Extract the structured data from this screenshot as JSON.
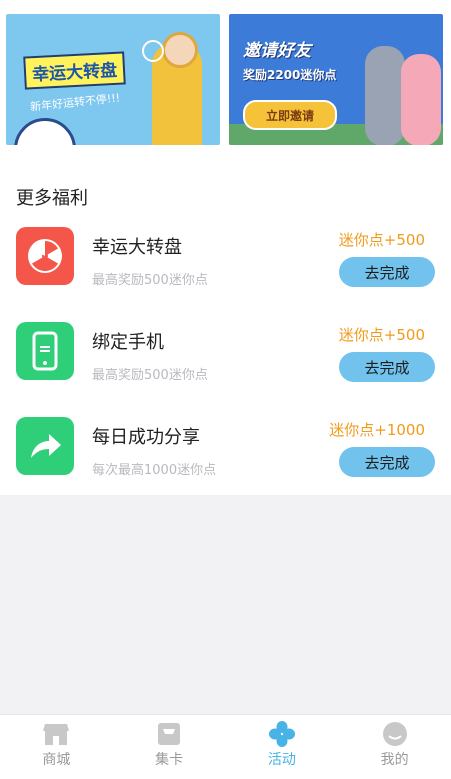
{
  "banners": {
    "left": {
      "title": "幸运大转盘",
      "subtitle": "新年好运转不停!!!"
    },
    "right": {
      "title": "邀请好友",
      "subtitle": "奖励2200迷你点",
      "button": "立即邀请"
    }
  },
  "section_title": "更多福利",
  "tasks": [
    {
      "name": "幸运大转盘",
      "desc": "最高奖励500迷你点",
      "reward": "迷你点+500",
      "button": "去完成",
      "icon": "radiation-icon",
      "color": "#f4564a"
    },
    {
      "name": "绑定手机",
      "desc": "最高奖励500迷你点",
      "reward": "迷你点+500",
      "button": "去完成",
      "icon": "phone-icon",
      "color": "#2fcf7a"
    },
    {
      "name": "每日成功分享",
      "desc": "每次最高1000迷你点",
      "reward": "迷你点+1000",
      "button": "去完成",
      "icon": "share-icon",
      "color": "#2fcf7a"
    }
  ],
  "nav": [
    {
      "label": "商城",
      "icon": "store-icon",
      "active": false
    },
    {
      "label": "集卡",
      "icon": "card-bag-icon",
      "active": false
    },
    {
      "label": "活动",
      "icon": "clover-icon",
      "active": true
    },
    {
      "label": "我的",
      "icon": "avatar-icon",
      "active": false
    }
  ],
  "colors": {
    "accent": "#47b3e6",
    "reward": "#f29a1a",
    "button": "#71c3ee"
  }
}
